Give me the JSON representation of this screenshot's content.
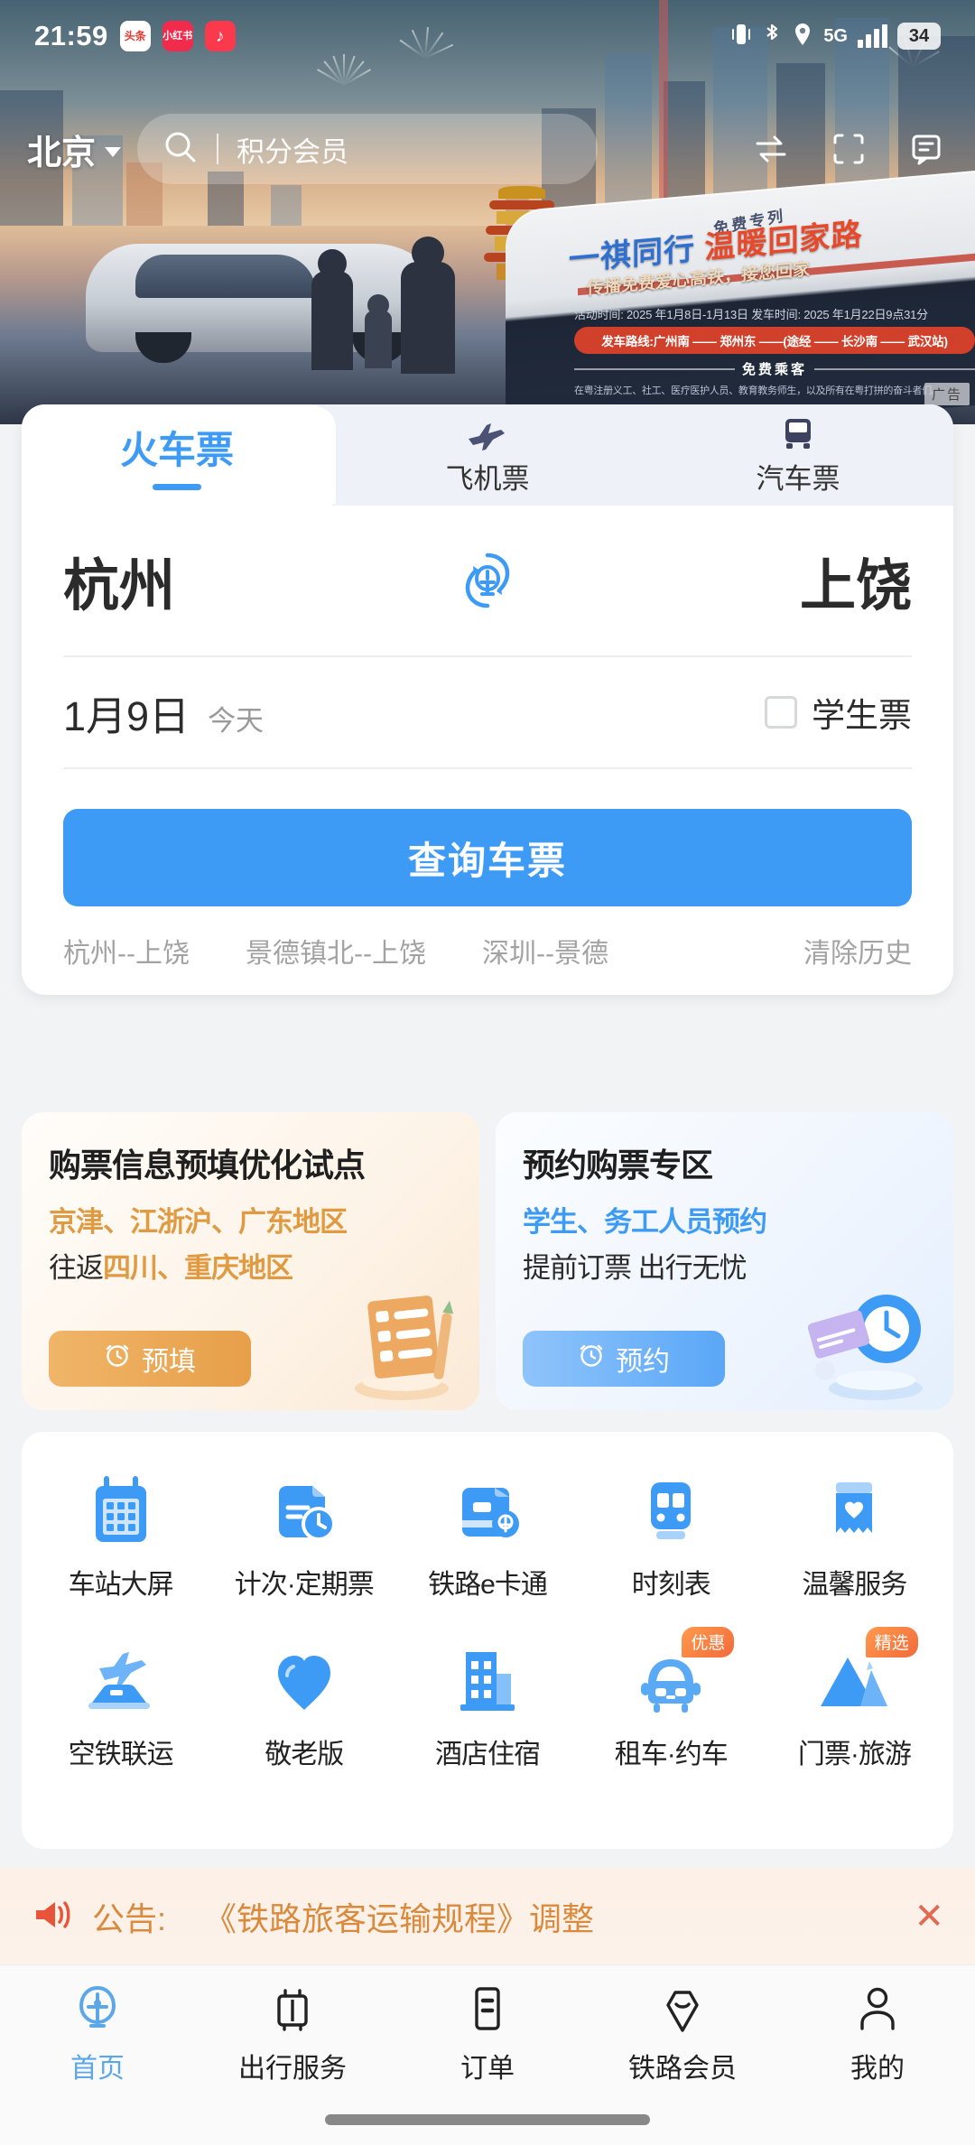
{
  "statusbar": {
    "time": "21:59",
    "apps": [
      {
        "name": "toutiao-app-icon",
        "text": "头条"
      },
      {
        "name": "xiaohongshu-app-icon",
        "text": "小红书"
      },
      {
        "name": "music-app-icon",
        "text": "♪"
      }
    ],
    "network": "5G",
    "battery": "34"
  },
  "header": {
    "city": "北京",
    "search_placeholder": "积分会员",
    "icons": [
      "transfer-icon",
      "scan-icon",
      "message-icon"
    ]
  },
  "banner": {
    "headline_blue": "一祺同行",
    "headline_red": "温暖回家路",
    "subline": "传播免费爱心高铁，接您回家",
    "train_label": "免费专列",
    "meta_prefix": "活动时间:",
    "meta_date_start": "2025",
    "meta_text": "活动时间: 2025 年1月8日-1月13日  发车时间: 2025 年1月22日9点31分",
    "route": "发车路线:广州南 —— 郑州东 ——(途经 —— 长沙南 —— 武汉站)",
    "free_title": "免费乘客",
    "fineprint": "在粤注册义工、社工、医疗医护人员、教育教务师生，以及所有在粤打拼的奋斗者们。",
    "ad_tag": "广告"
  },
  "booking": {
    "tabs": [
      {
        "label": "火车票",
        "icon": "train-icon",
        "active": true
      },
      {
        "label": "飞机票",
        "icon": "plane-icon",
        "active": false
      },
      {
        "label": "汽车票",
        "icon": "bus-icon",
        "active": false
      }
    ],
    "from_city": "杭州",
    "to_city": "上饶",
    "swap_icon": "swap-railway-icon",
    "date": "1月9日",
    "date_label": "今天",
    "student_label": "学生票",
    "student_checked": false,
    "search_label": "查询车票",
    "history": [
      "杭州--上饶",
      "景德镇北--上饶",
      "深圳--景德"
    ],
    "clear_history": "清除历史"
  },
  "promos": [
    {
      "title": "购票信息预填优化试点",
      "line1": "京津、江浙沪、广东地区",
      "line2_prefix": "往返",
      "line2_highlight": "四川、重庆地区",
      "button": "预填",
      "button_icon": "clock-icon",
      "art": "checklist-art"
    },
    {
      "title": "预约购票专区",
      "line1": "学生、务工人员预约",
      "line2_prefix": "提前订票 出行无忧",
      "line2_highlight": "",
      "button": "预约",
      "button_icon": "clock-icon",
      "art": "clock-card-art"
    }
  ],
  "grid": {
    "row1": [
      {
        "label": "车站大屏",
        "icon": "calendar-board-icon",
        "badge": ""
      },
      {
        "label": "计次·定期票",
        "icon": "ticket-clock-icon",
        "badge": ""
      },
      {
        "label": "铁路e卡通",
        "icon": "e-card-icon",
        "badge": ""
      },
      {
        "label": "时刻表",
        "icon": "timetable-train-icon",
        "badge": ""
      },
      {
        "label": "温馨服务",
        "icon": "heart-service-icon",
        "badge": ""
      }
    ],
    "row2": [
      {
        "label": "空铁联运",
        "icon": "air-rail-icon",
        "badge": ""
      },
      {
        "label": "敬老版",
        "icon": "heart-elder-icon",
        "badge": ""
      },
      {
        "label": "酒店住宿",
        "icon": "hotel-icon",
        "badge": ""
      },
      {
        "label": "租车·约车",
        "icon": "car-rental-icon",
        "badge": "优惠"
      },
      {
        "label": "门票·旅游",
        "icon": "ticket-travel-icon",
        "badge": "精选"
      }
    ]
  },
  "announcement": {
    "icon": "speaker-icon",
    "label": "公告:",
    "text": "《铁路旅客运输规程》调整",
    "close": "✕"
  },
  "nav": [
    {
      "label": "首页",
      "icon": "railway-home-icon",
      "active": true
    },
    {
      "label": "出行服务",
      "icon": "luggage-icon",
      "active": false
    },
    {
      "label": "订单",
      "icon": "order-list-icon",
      "active": false
    },
    {
      "label": "铁路会员",
      "icon": "member-diamond-icon",
      "active": false
    },
    {
      "label": "我的",
      "icon": "person-icon",
      "active": false
    }
  ],
  "colors": {
    "accent": "#3d9bf5",
    "orange": "#e09a42",
    "announce": "#d98a3d",
    "red_badge": "#f26a3a"
  }
}
